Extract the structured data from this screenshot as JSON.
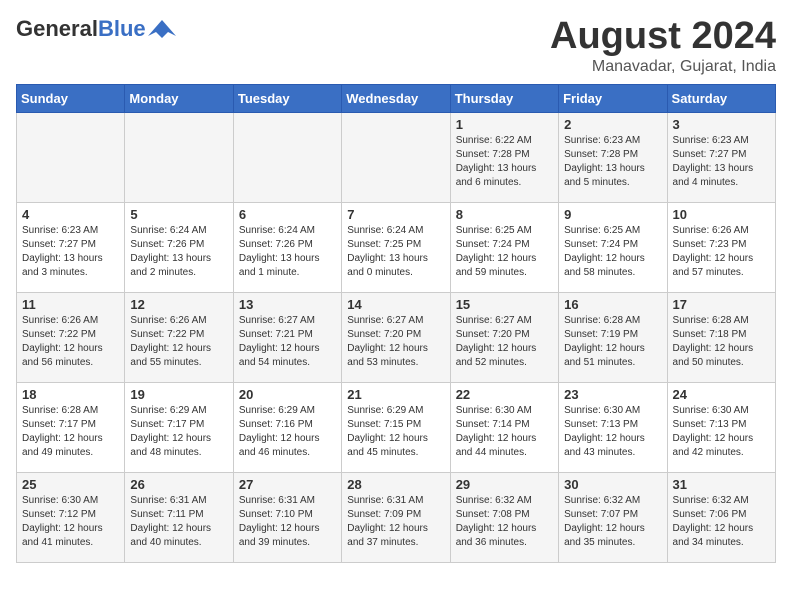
{
  "header": {
    "logo_line1": "General",
    "logo_line2": "Blue",
    "main_title": "August 2024",
    "subtitle": "Manavadar, Gujarat, India"
  },
  "calendar": {
    "days_of_week": [
      "Sunday",
      "Monday",
      "Tuesday",
      "Wednesday",
      "Thursday",
      "Friday",
      "Saturday"
    ],
    "weeks": [
      [
        {
          "day": "",
          "info": ""
        },
        {
          "day": "",
          "info": ""
        },
        {
          "day": "",
          "info": ""
        },
        {
          "day": "",
          "info": ""
        },
        {
          "day": "1",
          "info": "Sunrise: 6:22 AM\nSunset: 7:28 PM\nDaylight: 13 hours and 6 minutes."
        },
        {
          "day": "2",
          "info": "Sunrise: 6:23 AM\nSunset: 7:28 PM\nDaylight: 13 hours and 5 minutes."
        },
        {
          "day": "3",
          "info": "Sunrise: 6:23 AM\nSunset: 7:27 PM\nDaylight: 13 hours and 4 minutes."
        }
      ],
      [
        {
          "day": "4",
          "info": "Sunrise: 6:23 AM\nSunset: 7:27 PM\nDaylight: 13 hours and 3 minutes."
        },
        {
          "day": "5",
          "info": "Sunrise: 6:24 AM\nSunset: 7:26 PM\nDaylight: 13 hours and 2 minutes."
        },
        {
          "day": "6",
          "info": "Sunrise: 6:24 AM\nSunset: 7:26 PM\nDaylight: 13 hours and 1 minute."
        },
        {
          "day": "7",
          "info": "Sunrise: 6:24 AM\nSunset: 7:25 PM\nDaylight: 13 hours and 0 minutes."
        },
        {
          "day": "8",
          "info": "Sunrise: 6:25 AM\nSunset: 7:24 PM\nDaylight: 12 hours and 59 minutes."
        },
        {
          "day": "9",
          "info": "Sunrise: 6:25 AM\nSunset: 7:24 PM\nDaylight: 12 hours and 58 minutes."
        },
        {
          "day": "10",
          "info": "Sunrise: 6:26 AM\nSunset: 7:23 PM\nDaylight: 12 hours and 57 minutes."
        }
      ],
      [
        {
          "day": "11",
          "info": "Sunrise: 6:26 AM\nSunset: 7:22 PM\nDaylight: 12 hours and 56 minutes."
        },
        {
          "day": "12",
          "info": "Sunrise: 6:26 AM\nSunset: 7:22 PM\nDaylight: 12 hours and 55 minutes."
        },
        {
          "day": "13",
          "info": "Sunrise: 6:27 AM\nSunset: 7:21 PM\nDaylight: 12 hours and 54 minutes."
        },
        {
          "day": "14",
          "info": "Sunrise: 6:27 AM\nSunset: 7:20 PM\nDaylight: 12 hours and 53 minutes."
        },
        {
          "day": "15",
          "info": "Sunrise: 6:27 AM\nSunset: 7:20 PM\nDaylight: 12 hours and 52 minutes."
        },
        {
          "day": "16",
          "info": "Sunrise: 6:28 AM\nSunset: 7:19 PM\nDaylight: 12 hours and 51 minutes."
        },
        {
          "day": "17",
          "info": "Sunrise: 6:28 AM\nSunset: 7:18 PM\nDaylight: 12 hours and 50 minutes."
        }
      ],
      [
        {
          "day": "18",
          "info": "Sunrise: 6:28 AM\nSunset: 7:17 PM\nDaylight: 12 hours and 49 minutes."
        },
        {
          "day": "19",
          "info": "Sunrise: 6:29 AM\nSunset: 7:17 PM\nDaylight: 12 hours and 48 minutes."
        },
        {
          "day": "20",
          "info": "Sunrise: 6:29 AM\nSunset: 7:16 PM\nDaylight: 12 hours and 46 minutes."
        },
        {
          "day": "21",
          "info": "Sunrise: 6:29 AM\nSunset: 7:15 PM\nDaylight: 12 hours and 45 minutes."
        },
        {
          "day": "22",
          "info": "Sunrise: 6:30 AM\nSunset: 7:14 PM\nDaylight: 12 hours and 44 minutes."
        },
        {
          "day": "23",
          "info": "Sunrise: 6:30 AM\nSunset: 7:13 PM\nDaylight: 12 hours and 43 minutes."
        },
        {
          "day": "24",
          "info": "Sunrise: 6:30 AM\nSunset: 7:13 PM\nDaylight: 12 hours and 42 minutes."
        }
      ],
      [
        {
          "day": "25",
          "info": "Sunrise: 6:30 AM\nSunset: 7:12 PM\nDaylight: 12 hours and 41 minutes."
        },
        {
          "day": "26",
          "info": "Sunrise: 6:31 AM\nSunset: 7:11 PM\nDaylight: 12 hours and 40 minutes."
        },
        {
          "day": "27",
          "info": "Sunrise: 6:31 AM\nSunset: 7:10 PM\nDaylight: 12 hours and 39 minutes."
        },
        {
          "day": "28",
          "info": "Sunrise: 6:31 AM\nSunset: 7:09 PM\nDaylight: 12 hours and 37 minutes."
        },
        {
          "day": "29",
          "info": "Sunrise: 6:32 AM\nSunset: 7:08 PM\nDaylight: 12 hours and 36 minutes."
        },
        {
          "day": "30",
          "info": "Sunrise: 6:32 AM\nSunset: 7:07 PM\nDaylight: 12 hours and 35 minutes."
        },
        {
          "day": "31",
          "info": "Sunrise: 6:32 AM\nSunset: 7:06 PM\nDaylight: 12 hours and 34 minutes."
        }
      ]
    ]
  }
}
